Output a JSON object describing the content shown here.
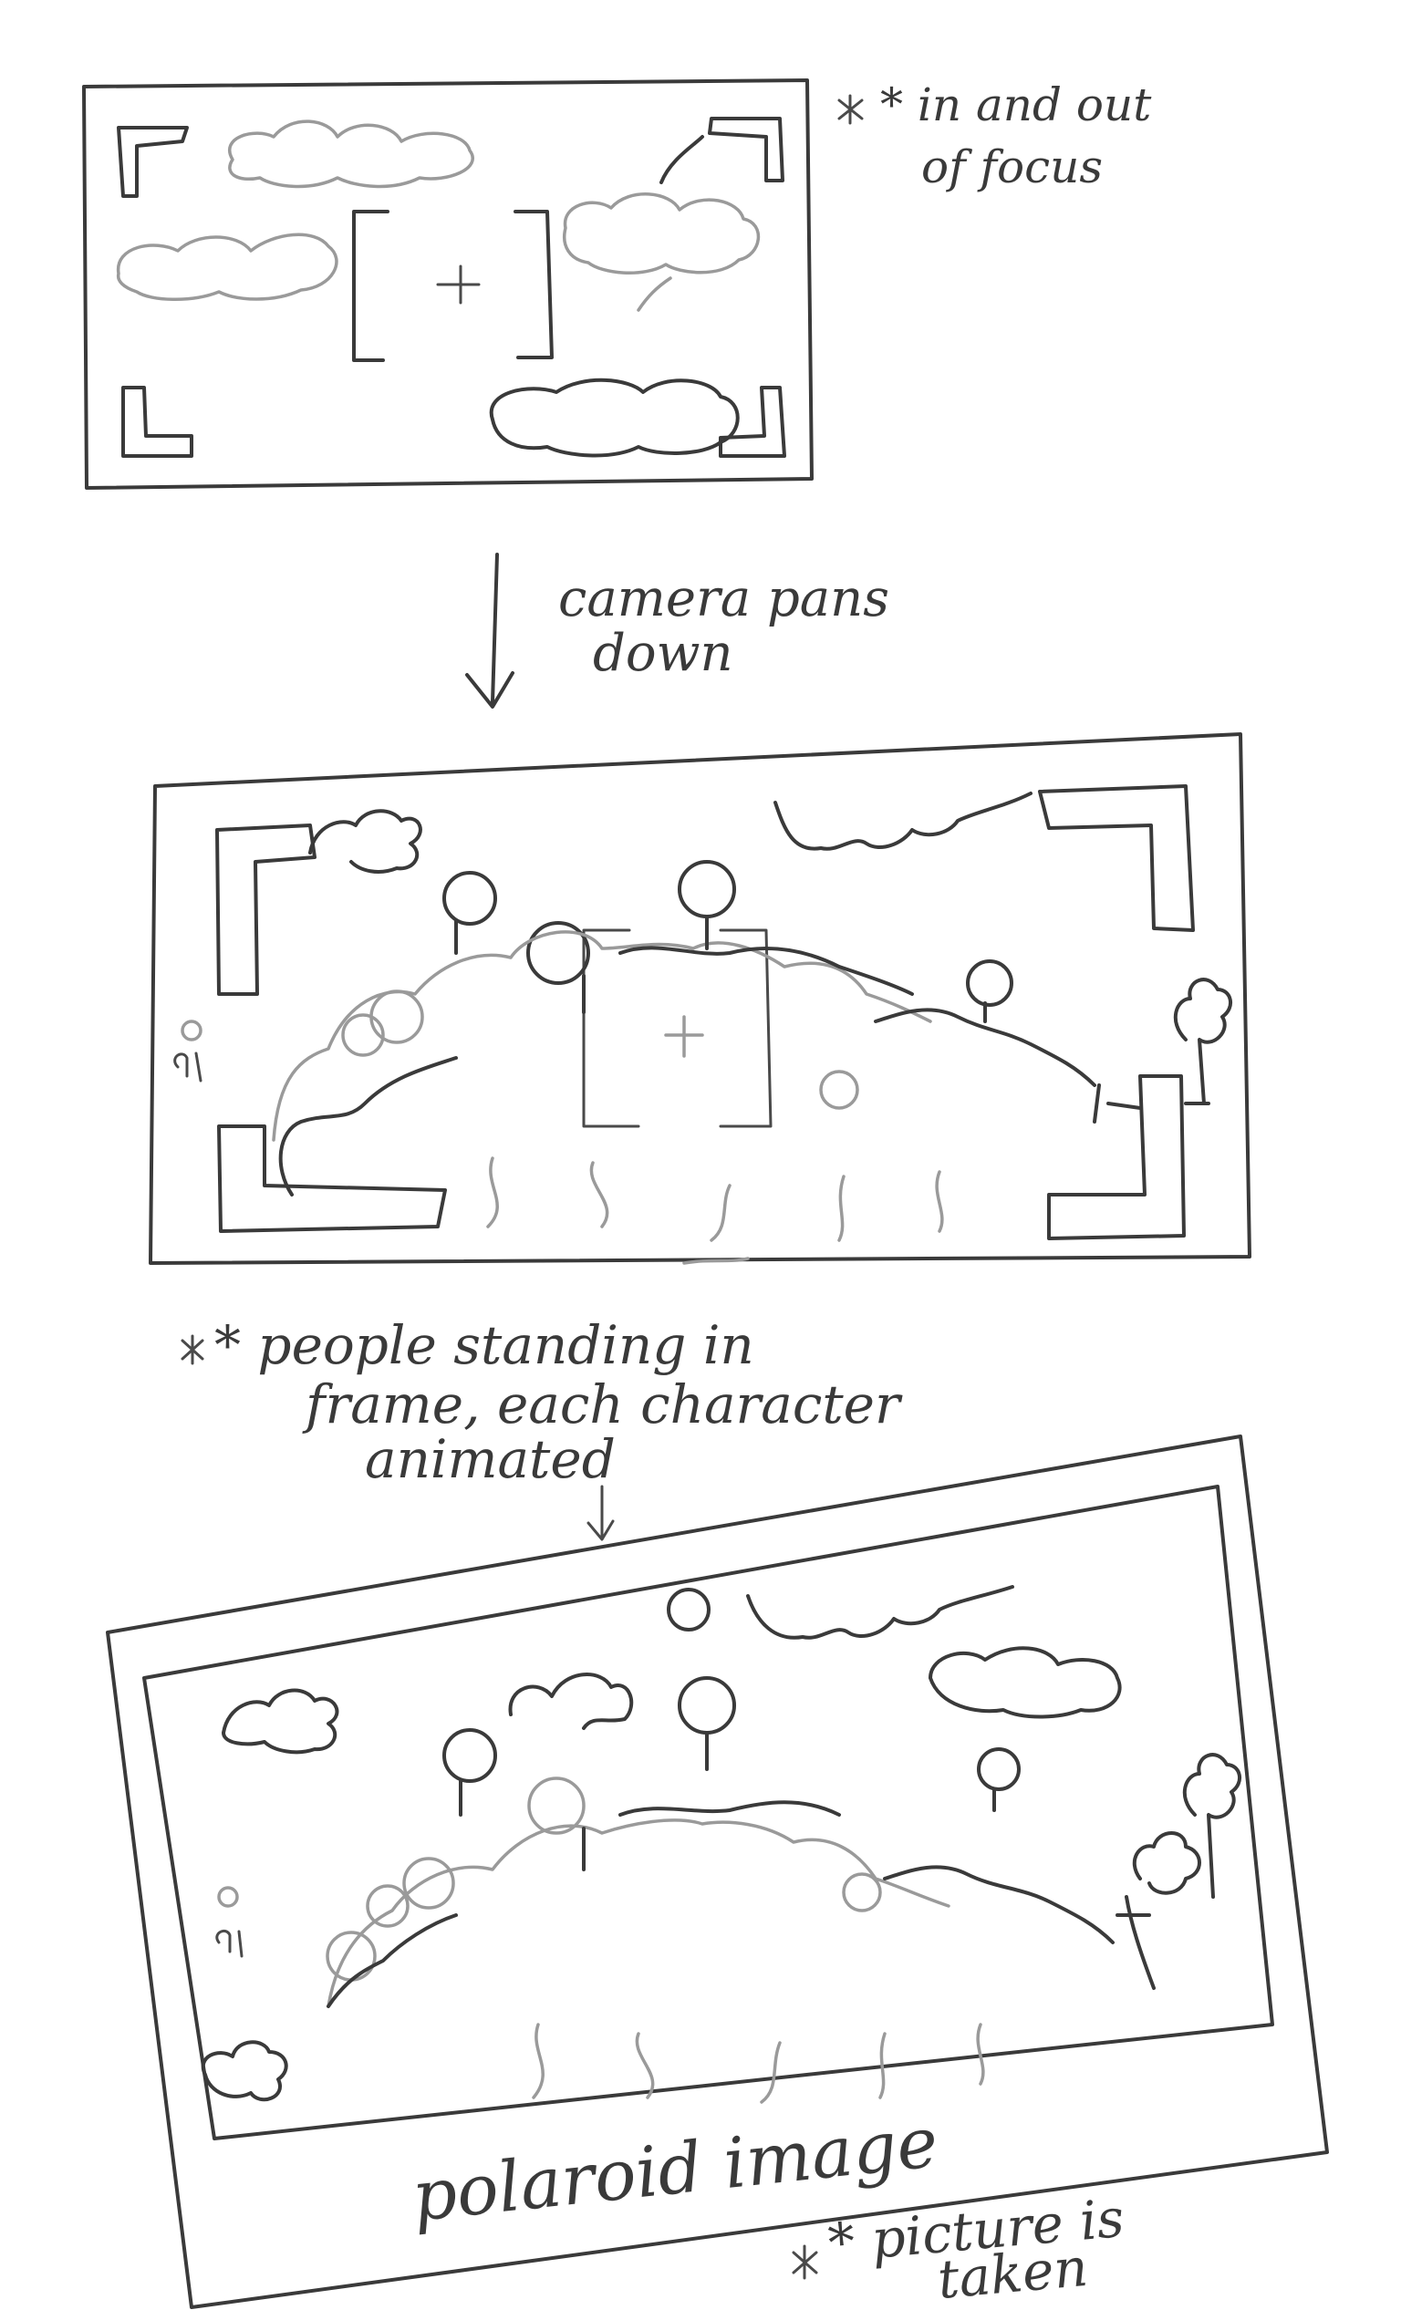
{
  "annotations": {
    "focus_note": [
      "* in and out",
      "of focus"
    ],
    "pan_note": [
      "camera pans",
      "down"
    ],
    "people_note": [
      "* people  standing in",
      "frame, each character",
      "animated"
    ],
    "polaroid_label": "polaroid  image",
    "picture_note": [
      "* picture is",
      "taken"
    ]
  },
  "frames": [
    {
      "id": "frame-1",
      "content": "sky with clouds, viewfinder"
    },
    {
      "id": "frame-2",
      "content": "people in frame, viewfinder"
    },
    {
      "id": "frame-3",
      "content": "polaroid with people"
    }
  ]
}
